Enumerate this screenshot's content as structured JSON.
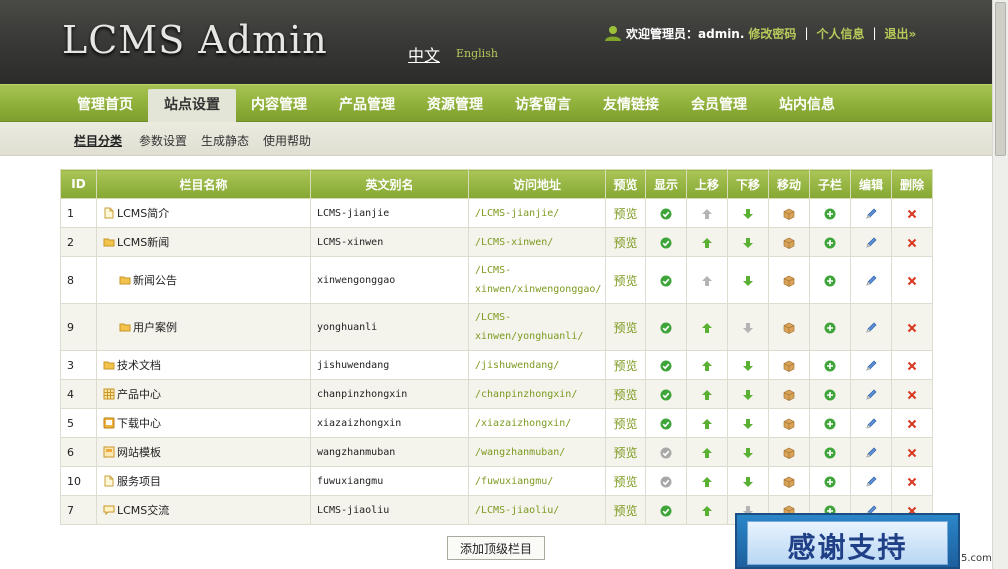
{
  "header": {
    "logo": "LCMS Admin",
    "lang_zh": "中文",
    "lang_en": "English",
    "welcome": "欢迎管理员：admin.",
    "change_password": "修改密码",
    "separator": "|",
    "profile": "个人信息",
    "logout": "退出»"
  },
  "nav": {
    "items": [
      "管理首页",
      "站点设置",
      "内容管理",
      "产品管理",
      "资源管理",
      "访客留言",
      "友情链接",
      "会员管理",
      "站内信息"
    ],
    "active_index": 1
  },
  "subnav": {
    "items": [
      "栏目分类",
      "参数设置",
      "生成静态",
      "使用帮助"
    ],
    "active_index": 0
  },
  "table": {
    "headers": [
      "ID",
      "栏目名称",
      "英文别名",
      "访问地址",
      "预览",
      "显示",
      "上移",
      "下移",
      "移动",
      "子栏",
      "编辑",
      "删除"
    ],
    "preview_label": "预览",
    "rows": [
      {
        "id": "1",
        "name": "LCMS简介",
        "icon": "page-icon",
        "indent": false,
        "alias": "LCMS-jianjie",
        "url": "/LCMS-jianjie/",
        "visible": true,
        "up": false,
        "down": true
      },
      {
        "id": "2",
        "name": "LCMS新闻",
        "icon": "folder-icon",
        "indent": false,
        "alias": "LCMS-xinwen",
        "url": "/LCMS-xinwen/",
        "visible": true,
        "up": true,
        "down": true
      },
      {
        "id": "8",
        "name": "新闻公告",
        "icon": "folder-icon",
        "indent": true,
        "alias": "xinwengonggao",
        "url": "/LCMS-xinwen/xinwengonggao/",
        "visible": true,
        "up": false,
        "down": true
      },
      {
        "id": "9",
        "name": "用户案例",
        "icon": "folder-icon",
        "indent": true,
        "alias": "yonghuanli",
        "url": "/LCMS-xinwen/yonghuanli/",
        "visible": true,
        "up": true,
        "down": false
      },
      {
        "id": "3",
        "name": "技术文档",
        "icon": "folder-icon",
        "indent": false,
        "alias": "jishuwendang",
        "url": "/jishuwendang/",
        "visible": true,
        "up": true,
        "down": true
      },
      {
        "id": "4",
        "name": "产品中心",
        "icon": "grid-icon",
        "indent": false,
        "alias": "chanpinzhongxin",
        "url": "/chanpinzhongxin/",
        "visible": true,
        "up": true,
        "down": true
      },
      {
        "id": "5",
        "name": "下载中心",
        "icon": "download-icon",
        "indent": false,
        "alias": "xiazaizhongxin",
        "url": "/xiazaizhongxin/",
        "visible": true,
        "up": true,
        "down": true
      },
      {
        "id": "6",
        "name": "网站模板",
        "icon": "template-icon",
        "indent": false,
        "alias": "wangzhanmuban",
        "url": "/wangzhanmuban/",
        "visible": false,
        "up": true,
        "down": true
      },
      {
        "id": "10",
        "name": "服务项目",
        "icon": "page-icon",
        "indent": false,
        "alias": "fuwuxiangmu",
        "url": "/fuwuxiangmu/",
        "visible": false,
        "up": true,
        "down": true
      },
      {
        "id": "7",
        "name": "LCMS交流",
        "icon": "chat-icon",
        "indent": false,
        "alias": "LCMS-jiaoliu",
        "url": "/LCMS-jiaoliu/",
        "visible": true,
        "up": true,
        "down": false
      }
    ]
  },
  "add_button": "添加顶级栏目",
  "banner": "感谢支持",
  "watermark": "5.com",
  "colors": {
    "header_bg": "#3a3b38",
    "nav_green": "#8fb03a",
    "link_green": "#7c9a1f",
    "accent_yellow": "#b8c85a"
  }
}
